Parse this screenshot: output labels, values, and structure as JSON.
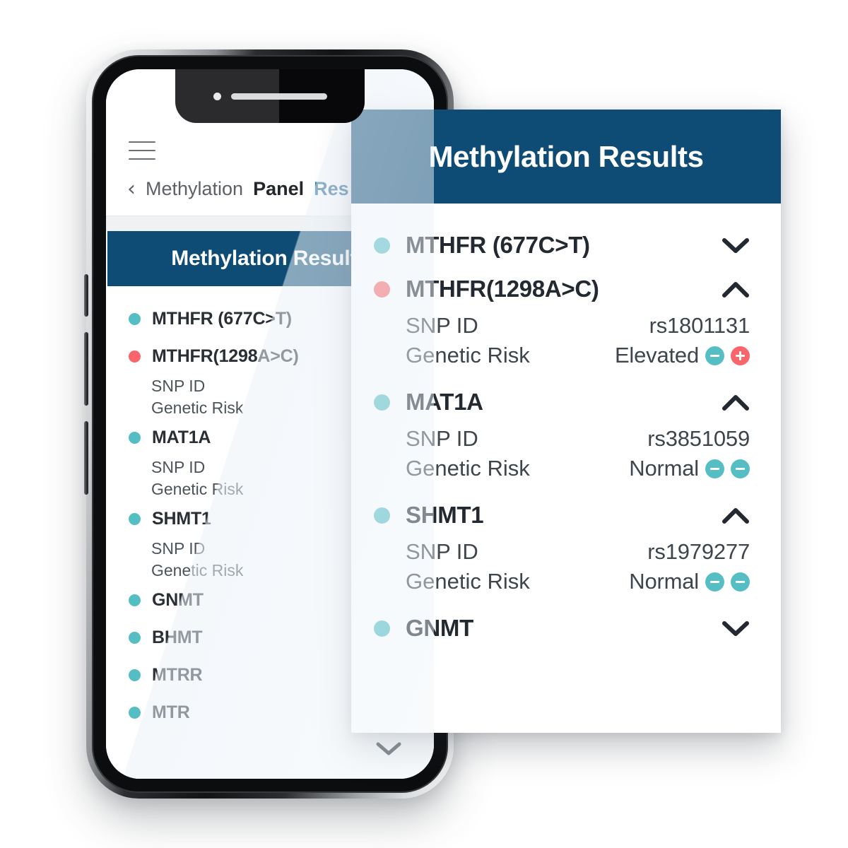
{
  "colors": {
    "navy": "#0e4c75",
    "teal": "#55bec4",
    "red": "#f9656a",
    "text_dark": "#232931",
    "text_body": "#3e454c"
  },
  "phone": {
    "status_bar": {
      "camera_icon": "camera-dot-icon",
      "speaker_icon": "speaker-grille-icon"
    },
    "menu_icon": "hamburger-menu-icon",
    "breadcrumb": {
      "back_icon": "chevron-left-icon",
      "part1": "Methylation ",
      "part2": "Panel ",
      "part3": "Res"
    },
    "card_title": "Methylation Results",
    "bottom_chevron_icon": "chevron-down-icon",
    "list": [
      {
        "gene": "MTHFR (677C>T)",
        "dot": "teal",
        "expanded": false,
        "details": []
      },
      {
        "gene": "MTHFR(1298A>C)",
        "dot": "red",
        "expanded": true,
        "details": [
          {
            "label": "SNP ID",
            "value": "rs18"
          },
          {
            "label": "Genetic Risk",
            "value": "Elevate"
          }
        ]
      },
      {
        "gene": "MAT1A",
        "dot": "teal",
        "expanded": true,
        "details": [
          {
            "label": "SNP ID",
            "value": "rs38"
          },
          {
            "label": "Genetic Risk",
            "value": "Norm"
          }
        ]
      },
      {
        "gene": "SHMT1",
        "dot": "teal",
        "expanded": true,
        "details": [
          {
            "label": "SNP ID",
            "value": "rs19"
          },
          {
            "label": "Genetic Risk",
            "value": "Norm"
          }
        ]
      },
      {
        "gene": "GNMT",
        "dot": "teal",
        "expanded": false,
        "details": []
      },
      {
        "gene": "BHMT",
        "dot": "teal",
        "expanded": false,
        "details": []
      },
      {
        "gene": "MTRR",
        "dot": "teal",
        "expanded": false,
        "details": []
      },
      {
        "gene": "MTR",
        "dot": "teal",
        "expanded": false,
        "details": []
      }
    ]
  },
  "card": {
    "title": "Methylation Results",
    "rows": [
      {
        "gene": "MTHFR (677C>T)",
        "dot": "teal",
        "expanded": false,
        "chevron_icon": "chevron-down-icon",
        "details": []
      },
      {
        "gene": "MTHFR(1298A>C)",
        "dot": "red",
        "expanded": true,
        "chevron_icon": "chevron-up-icon",
        "details": [
          {
            "label": "SNP ID",
            "value": "rs1801131",
            "badges": []
          },
          {
            "label": "Genetic Risk",
            "value": "Elevated",
            "badges": [
              {
                "kind": "minus",
                "color": "teal",
                "icon": "minus-badge-icon"
              },
              {
                "kind": "plus",
                "color": "red",
                "icon": "plus-badge-icon"
              }
            ]
          }
        ]
      },
      {
        "gene": "MAT1A",
        "dot": "teal",
        "expanded": true,
        "chevron_icon": "chevron-up-icon",
        "details": [
          {
            "label": "SNP ID",
            "value": "rs3851059",
            "badges": []
          },
          {
            "label": "Genetic Risk",
            "value": "Normal",
            "badges": [
              {
                "kind": "minus",
                "color": "teal",
                "icon": "minus-badge-icon"
              },
              {
                "kind": "minus",
                "color": "teal",
                "icon": "minus-badge-icon"
              }
            ]
          }
        ]
      },
      {
        "gene": "SHMT1",
        "dot": "teal",
        "expanded": true,
        "chevron_icon": "chevron-up-icon",
        "details": [
          {
            "label": "SNP ID",
            "value": "rs1979277",
            "badges": []
          },
          {
            "label": "Genetic Risk",
            "value": "Normal",
            "badges": [
              {
                "kind": "minus",
                "color": "teal",
                "icon": "minus-badge-icon"
              },
              {
                "kind": "minus",
                "color": "teal",
                "icon": "minus-badge-icon"
              }
            ]
          }
        ]
      },
      {
        "gene": "GNMT",
        "dot": "teal",
        "expanded": false,
        "chevron_icon": "chevron-down-icon",
        "details": []
      }
    ]
  }
}
